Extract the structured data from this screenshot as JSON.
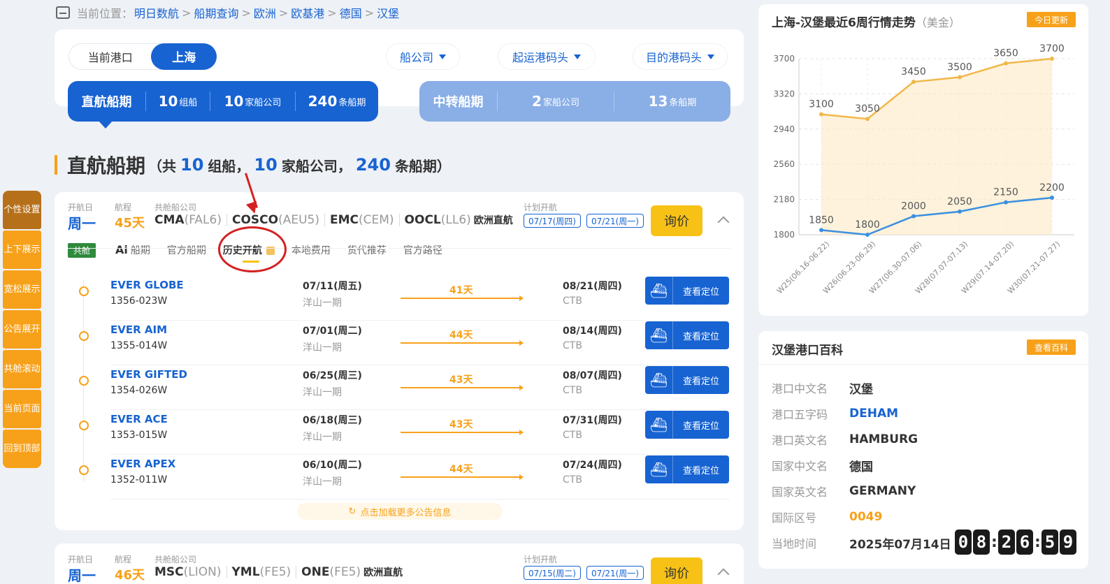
{
  "breadcrumb": {
    "prefix": "当前位置：",
    "items": [
      "明日数航",
      "船期查询",
      "欧洲",
      "欧基港",
      "德国",
      "汉堡"
    ]
  },
  "port_switch": {
    "label": "当前港口",
    "value": "上海"
  },
  "filters": [
    "船公司",
    "起运港码头",
    "目的港码头"
  ],
  "direct_band": {
    "title": "直航船期",
    "groups_num": "10",
    "groups_unit": "组船",
    "carriers_num": "10",
    "carriers_unit": "家船公司",
    "schedules_num": "240",
    "schedules_unit": "条船期"
  },
  "transit_band": {
    "title": "中转船期",
    "carriers_num": "2",
    "carriers_unit": "家船公司",
    "schedules_num": "13",
    "schedules_unit": "条船期"
  },
  "section": {
    "title": "直航船期",
    "p1": "（共",
    "n1": "10",
    "p2": "组船，",
    "n2": "10",
    "p3": "家船公司，",
    "n3": "240",
    "p4": "条船期）"
  },
  "sidenav": [
    "个性设置",
    "上下展示",
    "宽松展示",
    "公告展开",
    "共舱滚动",
    "当前页面",
    "回到顶部"
  ],
  "card1": {
    "day_label": "开航日",
    "day": "周一",
    "dur_label": "航程",
    "duration": "45天",
    "share_label": "共舱船公司",
    "carriers": [
      {
        "name": "CMA",
        "code": "(FAL6)"
      },
      {
        "name": "COSCO",
        "code": "(AEU5)"
      },
      {
        "name": "EMC",
        "code": "(CEM)"
      },
      {
        "name": "OOCL",
        "code": "(LL6)"
      }
    ],
    "route_type": "欧洲直航",
    "plan_label": "计划开航",
    "plan_dates": [
      "07/17(周四)",
      "07/21(周一)"
    ],
    "ask": "询价",
    "tag": "共舱",
    "tabs": [
      "船期",
      "官方船期",
      "历史开航",
      "本地费用",
      "货代推荐",
      "官方路径"
    ],
    "ai_prefix": "Ai",
    "rows": [
      {
        "vessel": "EVER GLOBE",
        "voyage": "1356-023W",
        "dep": "07/11(周五)",
        "term": "洋山一期",
        "days": "41天",
        "arr": "08/21(周四)",
        "aterm": "CTB",
        "btn": "查看定位"
      },
      {
        "vessel": "EVER AIM",
        "voyage": "1355-014W",
        "dep": "07/01(周二)",
        "term": "洋山一期",
        "days": "44天",
        "arr": "08/14(周四)",
        "aterm": "CTB",
        "btn": "查看定位"
      },
      {
        "vessel": "EVER GIFTED",
        "voyage": "1354-026W",
        "dep": "06/25(周三)",
        "term": "洋山一期",
        "days": "43天",
        "arr": "08/07(周四)",
        "aterm": "CTB",
        "btn": "查看定位"
      },
      {
        "vessel": "EVER ACE",
        "voyage": "1353-015W",
        "dep": "06/18(周三)",
        "term": "洋山一期",
        "days": "43天",
        "arr": "07/31(周四)",
        "aterm": "CTB",
        "btn": "查看定位"
      },
      {
        "vessel": "EVER APEX",
        "voyage": "1352-011W",
        "dep": "06/10(周二)",
        "term": "洋山一期",
        "days": "44天",
        "arr": "07/24(周四)",
        "aterm": "CTB",
        "btn": "查看定位"
      }
    ],
    "more": "点击加载更多公告信息"
  },
  "card2": {
    "day_label": "开航日",
    "day": "周一",
    "dur_label": "航程",
    "duration": "46天",
    "share_label": "共舱船公司",
    "carriers": [
      {
        "name": "MSC",
        "code": "(LION)"
      },
      {
        "name": "YML",
        "code": "(FE5)"
      },
      {
        "name": "ONE",
        "code": "(FE5)"
      }
    ],
    "route_type": "欧洲直航",
    "plan_label": "计划开航",
    "plan_dates": [
      "07/15(周二)",
      "07/21(周一)"
    ],
    "ask": "询价"
  },
  "chart_panel": {
    "title": "上海-汉堡最近6周行情走势",
    "unit": "（美金）",
    "badge": "今日更新"
  },
  "chart_data": {
    "type": "line",
    "categories": [
      "W25(06.16-06.22)",
      "W26(06.23-06.29)",
      "W27(06.30-07.06)",
      "W28(07.07-07.13)",
      "W29(07.14-07.20)",
      "W30(07.21-07.27)"
    ],
    "series": [
      {
        "values": [
          3100,
          3050,
          3450,
          3500,
          3650,
          3700
        ],
        "color": "#f0b84a"
      },
      {
        "values": [
          1850,
          1800,
          2000,
          2050,
          2150,
          2200
        ],
        "color": "#3b8fe0"
      }
    ],
    "yticks": [
      1800,
      2180,
      2560,
      2940,
      3320,
      3700
    ],
    "ylim": [
      1800,
      3700
    ],
    "grid": true
  },
  "info": {
    "title": "汉堡港口百科",
    "badge": "查看百科",
    "rows": [
      {
        "k": "港口中文名",
        "v": "汉堡"
      },
      {
        "k": "港口五字码",
        "v": "DEHAM"
      },
      {
        "k": "港口英文名",
        "v": "HAMBURG"
      },
      {
        "k": "国家中文名",
        "v": "德国"
      },
      {
        "k": "国家英文名",
        "v": "GERMANY"
      },
      {
        "k": "国际区号",
        "v": "0049"
      },
      {
        "k": "当地时间",
        "v": "2025年07月14日"
      }
    ],
    "clock": [
      "0",
      "8",
      "2",
      "6",
      "5",
      "9"
    ]
  }
}
